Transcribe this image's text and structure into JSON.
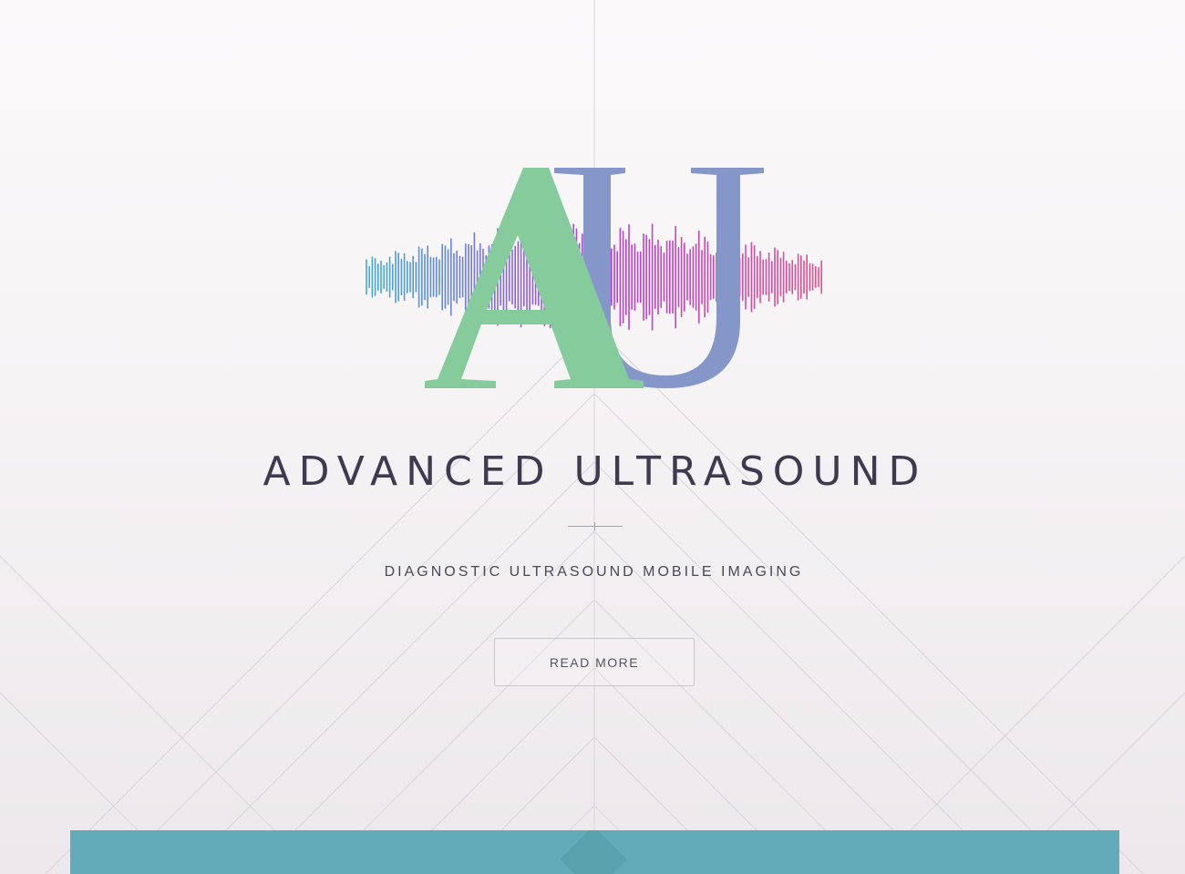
{
  "hero": {
    "logo_letters": "AU",
    "title": "ADVANCED ULTRASOUND",
    "subtitle": "DIAGNOSTIC ULTRASOUND MOBILE IMAGING",
    "button_label": "READ MORE"
  },
  "icons": {
    "logo": "au-soundwave-logo-icon"
  },
  "colors": {
    "letter_a": "#86cb9c",
    "letter_u": "#8597c9",
    "wave_start": "#3aaee6",
    "wave_mid": "#b43ee2",
    "wave_end": "#ec4f88",
    "title": "#3f3a4f",
    "teal_band": "#62abb8"
  }
}
